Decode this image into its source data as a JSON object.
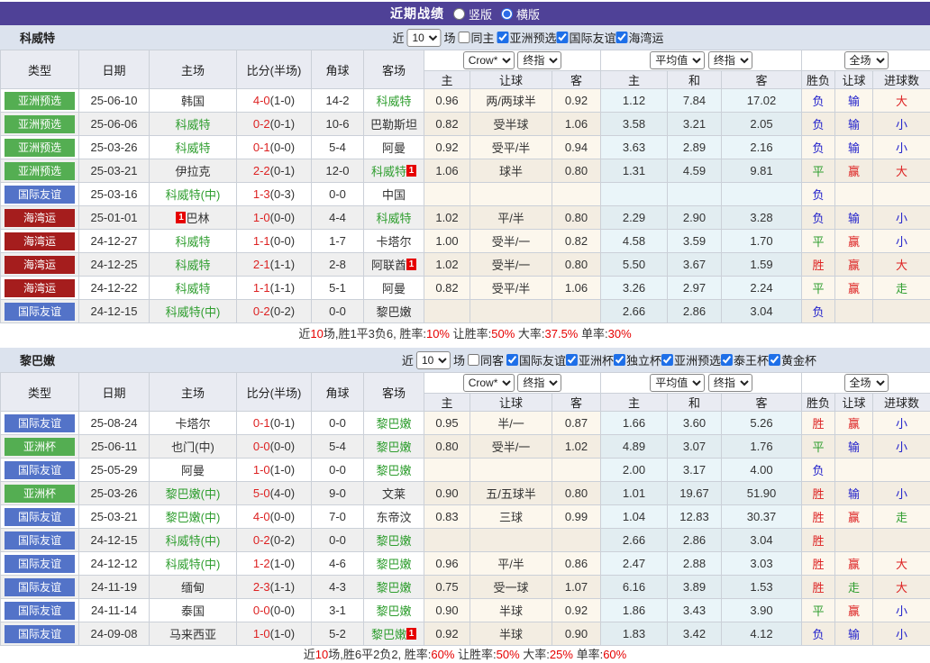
{
  "title_bar": {
    "title": "近期战绩",
    "vertical_label": "竖版",
    "horizontal_label": "横版",
    "vertical_checked": false,
    "horizontal_checked": true
  },
  "colors": {
    "header_purple": "#4f4197",
    "section_bar_bg": "#dce3ee",
    "table_header_bg": "#e9ebf2",
    "team_green": "#2f9e2f",
    "score_red": "#dd2222",
    "win_red": "#dd2222",
    "draw_green": "#2f9e2f",
    "lose_blue": "#2222cc",
    "red_card_badge": "#e60000",
    "checkbox_blue": "#1e6fe8",
    "badge": {
      "亚洲预选": "#54ae52",
      "亚洲杯": "#54ae52",
      "国际友谊": "#5373c8",
      "海湾运": "#a51d1d"
    }
  },
  "table_header": {
    "col_type": "类型",
    "col_date": "日期",
    "col_home": "主场",
    "col_score": "比分(半场)",
    "col_corner": "角球",
    "col_away": "客场",
    "dd_company": "Crow*",
    "dd_final1": "终指",
    "dd_avg": "平均值",
    "dd_final2": "终指",
    "dd_scope": "全场",
    "col_h": "主",
    "col_handicap": "让球",
    "col_a": "客",
    "col_avg_h": "主",
    "col_avg_d": "和",
    "col_avg_a": "客",
    "col_result": "胜负",
    "col_hresult": "让球",
    "col_goals": "进球数"
  },
  "sections": [
    {
      "team": "科威特",
      "filter": {
        "near": "近",
        "count": "10",
        "games": "场",
        "same": "同主",
        "same_checked": false,
        "competitions": [
          "亚洲预选",
          "国际友谊",
          "海湾运"
        ]
      },
      "rows": [
        {
          "type": "亚洲预选",
          "date": "25-06-10",
          "home": {
            "text": "韩国"
          },
          "ft": "4-0",
          "ht": "(1-0)",
          "corner": "14-2",
          "away": {
            "text": "科威特",
            "green": true
          },
          "oh": "0.96",
          "hcp": "两/两球半",
          "oa": "0.92",
          "ah": "1.12",
          "ad": "7.84",
          "aa": "17.02",
          "res": "负",
          "hres": "输",
          "goals": "大"
        },
        {
          "type": "亚洲预选",
          "date": "25-06-06",
          "home": {
            "text": "科威特",
            "green": true
          },
          "ft": "0-2",
          "ht": "(0-1)",
          "corner": "10-6",
          "away": {
            "text": "巴勒斯坦"
          },
          "oh": "0.82",
          "hcp": "受半球",
          "oa": "1.06",
          "ah": "3.58",
          "ad": "3.21",
          "aa": "2.05",
          "res": "负",
          "hres": "输",
          "goals": "小"
        },
        {
          "type": "亚洲预选",
          "date": "25-03-26",
          "home": {
            "text": "科威特",
            "green": true
          },
          "ft": "0-1",
          "ht": "(0-0)",
          "corner": "5-4",
          "away": {
            "text": "阿曼"
          },
          "oh": "0.92",
          "hcp": "受平/半",
          "oa": "0.94",
          "ah": "3.63",
          "ad": "2.89",
          "aa": "2.16",
          "res": "负",
          "hres": "输",
          "goals": "小"
        },
        {
          "type": "亚洲预选",
          "date": "25-03-21",
          "home": {
            "text": "伊拉克"
          },
          "ft": "2-2",
          "ht": "(0-1)",
          "corner": "12-0",
          "away": {
            "text": "科威特",
            "green": true,
            "badge": "1",
            "badge_pos": "after"
          },
          "oh": "1.06",
          "hcp": "球半",
          "oa": "0.80",
          "ah": "1.31",
          "ad": "4.59",
          "aa": "9.81",
          "res": "平",
          "hres": "赢",
          "goals": "大"
        },
        {
          "type": "国际友谊",
          "date": "25-03-16",
          "home": {
            "text": "科威特(中)",
            "green": true
          },
          "ft": "1-3",
          "ht": "(0-3)",
          "corner": "0-0",
          "away": {
            "text": "中国"
          },
          "oh": "",
          "hcp": "",
          "oa": "",
          "ah": "",
          "ad": "",
          "aa": "",
          "res": "负",
          "hres": "",
          "goals": ""
        },
        {
          "type": "海湾运",
          "date": "25-01-01",
          "home": {
            "text": "巴林",
            "badge": "1",
            "badge_pos": "before"
          },
          "ft": "1-0",
          "ht": "(0-0)",
          "corner": "4-4",
          "away": {
            "text": "科威特",
            "green": true
          },
          "oh": "1.02",
          "hcp": "平/半",
          "oa": "0.80",
          "ah": "2.29",
          "ad": "2.90",
          "aa": "3.28",
          "res": "负",
          "hres": "输",
          "goals": "小"
        },
        {
          "type": "海湾运",
          "date": "24-12-27",
          "home": {
            "text": "科威特",
            "green": true
          },
          "ft": "1-1",
          "ht": "(0-0)",
          "corner": "1-7",
          "away": {
            "text": "卡塔尔"
          },
          "oh": "1.00",
          "hcp": "受半/一",
          "oa": "0.82",
          "ah": "4.58",
          "ad": "3.59",
          "aa": "1.70",
          "res": "平",
          "hres": "赢",
          "goals": "小"
        },
        {
          "type": "海湾运",
          "date": "24-12-25",
          "home": {
            "text": "科威特",
            "green": true
          },
          "ft": "2-1",
          "ht": "(1-1)",
          "corner": "2-8",
          "away": {
            "text": "阿联酋",
            "badge": "1",
            "badge_pos": "after"
          },
          "oh": "1.02",
          "hcp": "受半/一",
          "oa": "0.80",
          "ah": "5.50",
          "ad": "3.67",
          "aa": "1.59",
          "res": "胜",
          "hres": "赢",
          "goals": "大"
        },
        {
          "type": "海湾运",
          "date": "24-12-22",
          "home": {
            "text": "科威特",
            "green": true
          },
          "ft": "1-1",
          "ht": "(1-1)",
          "corner": "5-1",
          "away": {
            "text": "阿曼"
          },
          "oh": "0.82",
          "hcp": "受平/半",
          "oa": "1.06",
          "ah": "3.26",
          "ad": "2.97",
          "aa": "2.24",
          "res": "平",
          "hres": "赢",
          "goals": "走"
        },
        {
          "type": "国际友谊",
          "date": "24-12-15",
          "home": {
            "text": "科威特(中)",
            "green": true
          },
          "ft": "0-2",
          "ht": "(0-2)",
          "corner": "0-0",
          "away": {
            "text": "黎巴嫩"
          },
          "oh": "",
          "hcp": "",
          "oa": "",
          "ah": "2.66",
          "ad": "2.86",
          "aa": "3.04",
          "res": "负",
          "hres": "",
          "goals": ""
        }
      ],
      "summary": {
        "t1": "近",
        "n1": "10",
        "t2": "场,胜1平3负6, 胜率:",
        "n2": "10%",
        "t3": " 让胜率:",
        "n3": "50%",
        "t4": " 大率:",
        "n4": "37.5%",
        "t5": " 单率:",
        "n5": "30%"
      }
    },
    {
      "team": "黎巴嫩",
      "filter": {
        "near": "近",
        "count": "10",
        "games": "场",
        "same": "同客",
        "same_checked": false,
        "competitions": [
          "国际友谊",
          "亚洲杯",
          "独立杯",
          "亚洲预选",
          "泰王杯",
          "黄金杯"
        ]
      },
      "rows": [
        {
          "type": "国际友谊",
          "date": "25-08-24",
          "home": {
            "text": "卡塔尔"
          },
          "ft": "0-1",
          "ht": "(0-1)",
          "corner": "0-0",
          "away": {
            "text": "黎巴嫩",
            "green": true
          },
          "oh": "0.95",
          "hcp": "半/一",
          "oa": "0.87",
          "ah": "1.66",
          "ad": "3.60",
          "aa": "5.26",
          "res": "胜",
          "hres": "赢",
          "goals": "小"
        },
        {
          "type": "亚洲杯",
          "date": "25-06-11",
          "home": {
            "text": "也门(中)"
          },
          "ft": "0-0",
          "ht": "(0-0)",
          "corner": "5-4",
          "away": {
            "text": "黎巴嫩",
            "green": true
          },
          "oh": "0.80",
          "hcp": "受半/一",
          "oa": "1.02",
          "ah": "4.89",
          "ad": "3.07",
          "aa": "1.76",
          "res": "平",
          "hres": "输",
          "goals": "小"
        },
        {
          "type": "国际友谊",
          "date": "25-05-29",
          "home": {
            "text": "阿曼"
          },
          "ft": "1-0",
          "ht": "(1-0)",
          "corner": "0-0",
          "away": {
            "text": "黎巴嫩",
            "green": true
          },
          "oh": "",
          "hcp": "",
          "oa": "",
          "ah": "2.00",
          "ad": "3.17",
          "aa": "4.00",
          "res": "负",
          "hres": "",
          "goals": ""
        },
        {
          "type": "亚洲杯",
          "date": "25-03-26",
          "home": {
            "text": "黎巴嫩(中)",
            "green": true
          },
          "ft": "5-0",
          "ht": "(4-0)",
          "corner": "9-0",
          "away": {
            "text": "文莱"
          },
          "oh": "0.90",
          "hcp": "五/五球半",
          "oa": "0.80",
          "ah": "1.01",
          "ad": "19.67",
          "aa": "51.90",
          "res": "胜",
          "hres": "输",
          "goals": "小"
        },
        {
          "type": "国际友谊",
          "date": "25-03-21",
          "home": {
            "text": "黎巴嫩(中)",
            "green": true
          },
          "ft": "4-0",
          "ht": "(0-0)",
          "corner": "7-0",
          "away": {
            "text": "东帝汶"
          },
          "oh": "0.83",
          "hcp": "三球",
          "oa": "0.99",
          "ah": "1.04",
          "ad": "12.83",
          "aa": "30.37",
          "res": "胜",
          "hres": "赢",
          "goals": "走"
        },
        {
          "type": "国际友谊",
          "date": "24-12-15",
          "home": {
            "text": "科威特(中)",
            "green": true
          },
          "ft": "0-2",
          "ht": "(0-2)",
          "corner": "0-0",
          "away": {
            "text": "黎巴嫩",
            "green": true
          },
          "oh": "",
          "hcp": "",
          "oa": "",
          "ah": "2.66",
          "ad": "2.86",
          "aa": "3.04",
          "res": "胜",
          "hres": "",
          "goals": ""
        },
        {
          "type": "国际友谊",
          "date": "24-12-12",
          "home": {
            "text": "科威特(中)",
            "green": true
          },
          "ft": "1-2",
          "ht": "(1-0)",
          "corner": "4-6",
          "away": {
            "text": "黎巴嫩",
            "green": true
          },
          "oh": "0.96",
          "hcp": "平/半",
          "oa": "0.86",
          "ah": "2.47",
          "ad": "2.88",
          "aa": "3.03",
          "res": "胜",
          "hres": "赢",
          "goals": "大"
        },
        {
          "type": "国际友谊",
          "date": "24-11-19",
          "home": {
            "text": "缅甸"
          },
          "ft": "2-3",
          "ht": "(1-1)",
          "corner": "4-3",
          "away": {
            "text": "黎巴嫩",
            "green": true
          },
          "oh": "0.75",
          "hcp": "受一球",
          "oa": "1.07",
          "ah": "6.16",
          "ad": "3.89",
          "aa": "1.53",
          "res": "胜",
          "hres": "走",
          "goals": "大"
        },
        {
          "type": "国际友谊",
          "date": "24-11-14",
          "home": {
            "text": "泰国"
          },
          "ft": "0-0",
          "ht": "(0-0)",
          "corner": "3-1",
          "away": {
            "text": "黎巴嫩",
            "green": true
          },
          "oh": "0.90",
          "hcp": "半球",
          "oa": "0.92",
          "ah": "1.86",
          "ad": "3.43",
          "aa": "3.90",
          "res": "平",
          "hres": "赢",
          "goals": "小"
        },
        {
          "type": "国际友谊",
          "date": "24-09-08",
          "home": {
            "text": "马来西亚"
          },
          "ft": "1-0",
          "ht": "(1-0)",
          "corner": "5-2",
          "away": {
            "text": "黎巴嫩",
            "green": true,
            "badge": "1",
            "badge_pos": "after"
          },
          "oh": "0.92",
          "hcp": "半球",
          "oa": "0.90",
          "ah": "1.83",
          "ad": "3.42",
          "aa": "4.12",
          "res": "负",
          "hres": "输",
          "goals": "小"
        }
      ],
      "summary": {
        "t1": "近",
        "n1": "10",
        "t2": "场,胜6平2负2, 胜率:",
        "n2": "60%",
        "t3": " 让胜率:",
        "n3": "50%",
        "t4": " 大率:",
        "n4": "25%",
        "t5": " 单率:",
        "n5": "60%"
      }
    }
  ]
}
